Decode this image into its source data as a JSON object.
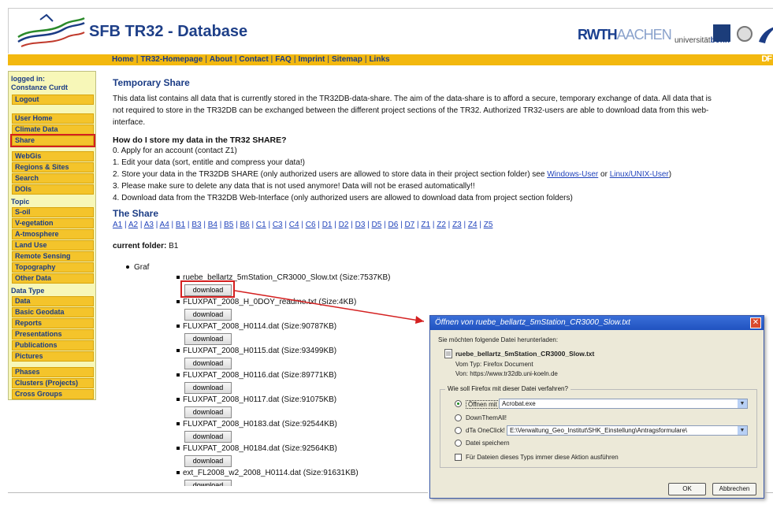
{
  "header": {
    "site_title": "SFB TR32 - Database",
    "rwth_bold": "RWTH",
    "rwth_thin": "AACHEN",
    "bonn_pre": "universität",
    "bonn_bold": "bonn",
    "dfg": "DF"
  },
  "nav": {
    "items": [
      "Home",
      "TR32-Homepage",
      "About",
      "Contact",
      "FAQ",
      "Imprint",
      "Sitemap",
      "Links"
    ]
  },
  "sidebar": {
    "logged_in_label": "logged in:",
    "user": "Constanze Curdt",
    "logout": "Logout",
    "group1": [
      "User Home",
      "Climate Data",
      "Share"
    ],
    "group2": [
      "WebGis",
      "Regions & Sites",
      "Search",
      "DOIs"
    ],
    "topic_label": "Topic",
    "topics": [
      "S-oil",
      "V-egetation",
      "A-tmosphere",
      "Land Use",
      "Remote Sensing",
      "Topography",
      "Other Data"
    ],
    "datatype_label": "Data Type",
    "datatypes": [
      "Data",
      "Basic Geodata",
      "Reports",
      "Presentations",
      "Publications",
      "Pictures"
    ],
    "group5": [
      "Phases",
      "Clusters (Projects)",
      "Cross Groups"
    ]
  },
  "main": {
    "title": "Temporary Share",
    "intro": "This data list contains all data that is currently stored in the TR32DB-data-share. The aim of the data-share is to afford a secure, temporary exchange of data. All data that is not required to store in the TR32DB can be exchanged between the different project sections of the TR32. Authorized TR32-users are able to download data from this web-interface.",
    "howto_title": "How do I store my data in the TR32 SHARE?",
    "steps": {
      "s0": "0. Apply for an account (contact Z1)",
      "s1": "1. Edit your data (sort, entitle and compress your data!)",
      "s2_pre": "2. Store your data in the TR32DB SHARE (only authorized users are allowed to store data in their project section folder) see ",
      "s2_link1": "Windows-User",
      "s2_mid": " or ",
      "s2_link2": "Linux/UNIX-User",
      "s2_post": ")",
      "s3": "3. Please make sure to delete any data that is not used anymore! Data will not be erased automatically!!",
      "s4": "4. Download data from the TR32DB Web-Interface (only authorized users are allowed to download data from project section folders)"
    },
    "share_title": "The Share",
    "share_links": [
      "A1",
      "A2",
      "A3",
      "A4",
      "B1",
      "B3",
      "B4",
      "B5",
      "B6",
      "C1",
      "C3",
      "C4",
      "C6",
      "D1",
      "D2",
      "D3",
      "D5",
      "D6",
      "D7",
      "Z1",
      "Z2",
      "Z3",
      "Z4",
      "Z5"
    ],
    "current_folder_label": "current folder:",
    "current_folder": "B1",
    "graf": "Graf",
    "download_label": "download",
    "files": [
      "ruebe_bellartz_5mStation_CR3000_Slow.txt (Size:7537KB)",
      "FLUXPAT_2008_H_0DOY_readme.txt (Size:4KB)",
      "FLUXPAT_2008_H0114.dat (Size:90787KB)",
      "FLUXPAT_2008_H0115.dat (Size:93499KB)",
      "FLUXPAT_2008_H0116.dat (Size:89771KB)",
      "FLUXPAT_2008_H0117.dat (Size:91075KB)",
      "FLUXPAT_2008_H0183.dat (Size:92544KB)",
      "FLUXPAT_2008_H0184.dat (Size:92564KB)",
      "ext_FL2008_w2_2008_H0114.dat (Size:91631KB)"
    ]
  },
  "dialog": {
    "title": "Öffnen von ruebe_bellartz_5mStation_CR3000_Slow.txt",
    "close": "✕",
    "intro": "Sie möchten folgende Datei herunterladen:",
    "filename": "ruebe_bellartz_5mStation_CR3000_Slow.txt",
    "type_line": "Vom Typ:  Firefox Document",
    "from_line": "Von:  https://www.tr32db.uni-koeln.de",
    "group_label": "Wie soll Firefox mit dieser Datei verfahren?",
    "open_with_label": "Öffnen mit",
    "open_with_value": "Acrobat.exe",
    "downthemall": "DownThemAll!",
    "dta_label": "dTa OneClick!",
    "dta_path": "E:\\Verwaltung_Geo_Institut\\SHK_Einstellung\\Antragsformulare\\",
    "save_file": "Datei speichern",
    "always_label": "Für Dateien dieses Typs immer diese Aktion ausführen",
    "ok": "OK",
    "cancel": "Abbrechen"
  }
}
